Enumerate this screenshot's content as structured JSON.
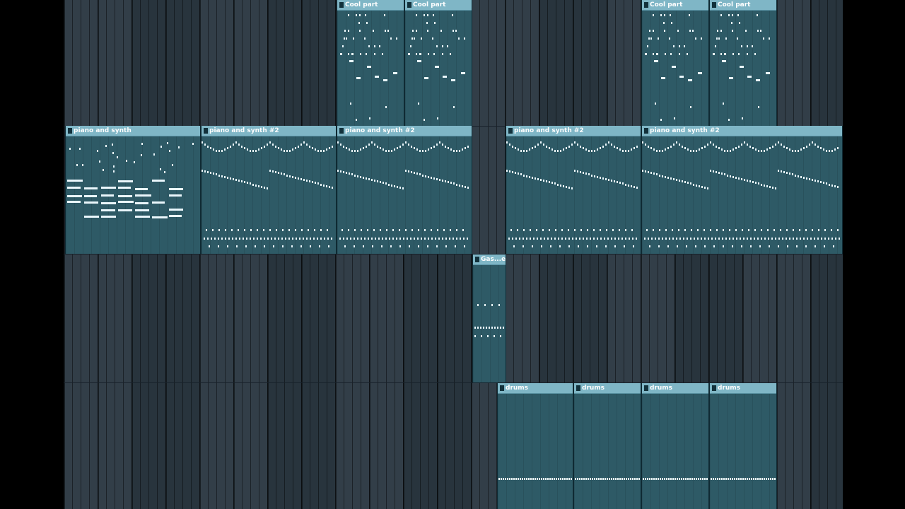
{
  "clip_labels": {
    "cool_part": "Cool part",
    "piano_and_synth": "piano and synth",
    "piano_and_synth_2": "piano and synth #2",
    "gas_ent": "Gas...ent",
    "drums": "drums"
  },
  "colors": {
    "background": "#2a3741",
    "clip_body": "#2e5a66",
    "clip_header": "#7fb6c6",
    "note": "#eaf6fb"
  }
}
